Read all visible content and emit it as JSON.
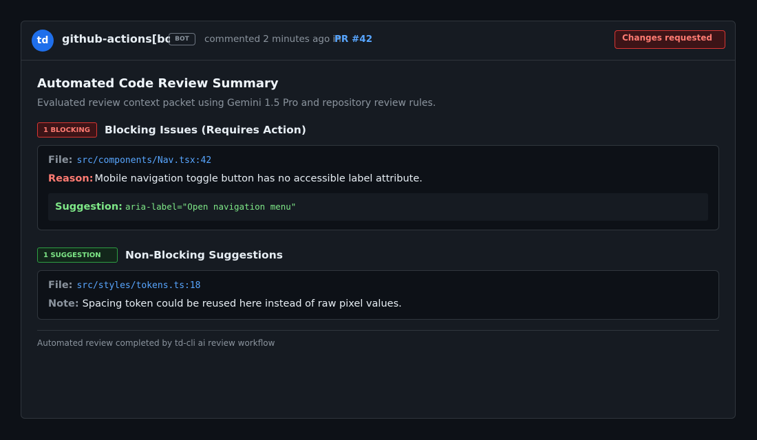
{
  "comment": {
    "avatar_initials": "td",
    "author": "github-actions[bot]",
    "bot_badge": "BOT",
    "meta_text": "commented 2 minutes ago in",
    "pr_link": "PR #42",
    "status": "Changes requested"
  },
  "summary": {
    "title": "Automated Code Review Summary",
    "subtitle": "Evaluated review context packet using Gemini 1.5 Pro and repository review rules."
  },
  "blocking": {
    "tag": "1 BLOCKING",
    "heading": "Blocking Issues (Requires Action)",
    "items": [
      {
        "file_label": "File:",
        "file": "src/components/Nav.tsx:42",
        "reason_label": "Reason:",
        "reason": "Mobile navigation toggle button has no accessible label attribute.",
        "suggestion_label": "Suggestion:",
        "suggestion_code": "aria-label=\"Open navigation menu\""
      }
    ]
  },
  "non_blocking": {
    "tag": "1 SUGGESTION",
    "heading": "Non-Blocking Suggestions",
    "items": [
      {
        "file_label": "File:",
        "file": "src/styles/tokens.ts:18",
        "note_label": "Note:",
        "note": "Spacing token could be reused here instead of raw pixel values."
      }
    ]
  },
  "footer": "Automated review completed by td-cli ai review workflow",
  "colors": {
    "accent": "#58a6ff",
    "danger": "#ff7b72",
    "success": "#7ee787",
    "avatar_bg": "#1f6feb"
  }
}
